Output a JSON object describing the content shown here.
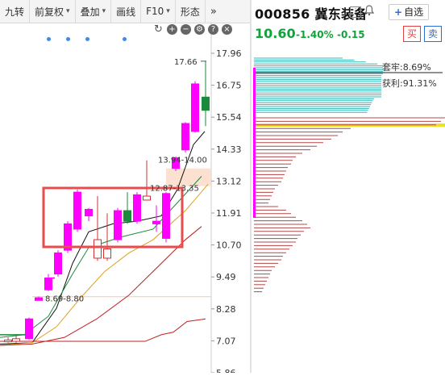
{
  "toolbar": {
    "items": [
      {
        "label": "九转",
        "has_caret": false
      },
      {
        "label": "前复权",
        "has_caret": true
      },
      {
        "label": "叠加",
        "has_caret": true
      },
      {
        "label": "画线",
        "has_caret": false
      },
      {
        "label": "F10",
        "has_caret": true
      },
      {
        "label": "形态",
        "has_caret": false
      }
    ],
    "more_label": "»",
    "caret": "▾"
  },
  "chart_tools": {
    "icons": [
      "refresh-icon",
      "zoom-in-icon",
      "zoom-out-icon",
      "settings-icon",
      "help-icon",
      "close-icon"
    ],
    "glyphs": [
      "↻",
      "+",
      "−",
      "⚙",
      "?",
      "×"
    ]
  },
  "kline": {
    "price_ticks": [
      "17.96",
      "16.75",
      "15.54",
      "14.33",
      "13.12",
      "11.91",
      "10.70",
      "9.49",
      "8.28",
      "7.07",
      "5.86"
    ],
    "annotations": {
      "high_label": "17.66",
      "zone1_label": "13.94-14.00",
      "zone2_label": "12.87-13.35",
      "zone3_label": "8.69-8.80"
    },
    "colors": {
      "up": "#ff00ff",
      "down": "#1a8a3c",
      "box": "#e84c4c",
      "ma1": "#111111",
      "ma2": "#1a8a3c",
      "ma3": "#e0a020",
      "ma4": "#c02020"
    }
  },
  "quote": {
    "code_name": "000856 冀东装备",
    "info_glyph": "i",
    "bell_glyph": "🔔",
    "fav_plus": "+",
    "fav_label": "自选",
    "last_price": "10.60",
    "pct_change": "-1.40%",
    "change": "-0.15",
    "buy_label": "买",
    "sell_label": "卖"
  },
  "chips": {
    "trapped_label": "套牢:8.69%",
    "profit_label": "获利:91.31%",
    "colors": {
      "trapped": "#2fb8b8",
      "profit": "#b04848",
      "current": "#e6e61e",
      "marker": "#ff00ff"
    }
  }
}
